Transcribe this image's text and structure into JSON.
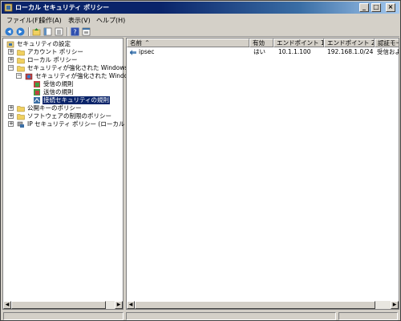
{
  "window": {
    "title": "ローカル セキュリティ ポリシー",
    "min_glyph": "_",
    "max_glyph": "□",
    "close_glyph": "×"
  },
  "menu": [
    "ファイル(F)",
    "操作(A)",
    "表示(V)",
    "ヘルプ(H)"
  ],
  "toolbar": {
    "icons": [
      "back-icon",
      "forward-icon",
      "up-folder-icon",
      "show-hide-tree-icon",
      "export-list-icon",
      "help-icon",
      "properties-icon"
    ]
  },
  "tree": {
    "root": "セキュリティの設定",
    "account_policy": "アカウント ポリシー",
    "local_policy": "ローカル ポリシー",
    "firewall": "セキュリティが強化された Windows ファイア",
    "firewall_child": "セキュリティが強化された Windows ファ",
    "inbound": "受信の規則",
    "outbound": "送信の規則",
    "connection_security": "接続セキュリティの規則",
    "public_key": "公開キーのポリシー",
    "software_restriction": "ソフトウェアの制限のポリシー",
    "ipsec_policy": "IP セキュリティ ポリシー (ローカル コンピュー"
  },
  "list": {
    "columns": [
      "名前",
      "有効",
      "エンドポイント 1",
      "エンドポイント 2",
      "認証モード"
    ],
    "rows": [
      {
        "name": "ipsec",
        "enabled": "はい",
        "endpoint1": "10.1.1.100",
        "endpoint2": "192.168.1.0/24",
        "auth": "受信および"
      }
    ]
  },
  "colors": {
    "selection": "#0a246a",
    "title_start": "#0a246a",
    "title_end": "#a6caf0",
    "chrome": "#d4d0c8"
  }
}
